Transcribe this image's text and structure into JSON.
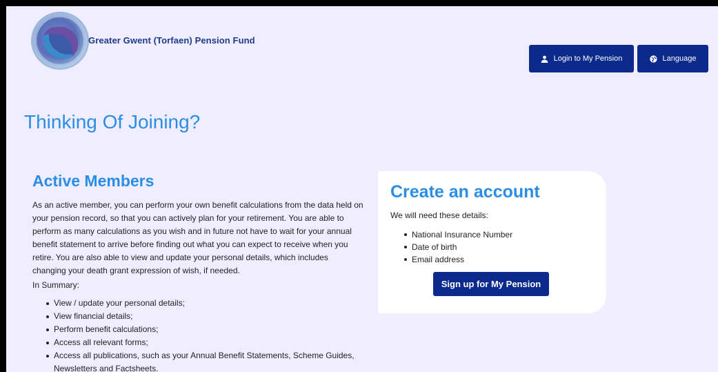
{
  "header": {
    "org_name": "Greater Gwent (Torfaen) Pension Fund",
    "login_label": "Login to My Pension",
    "language_label": "Language"
  },
  "main": {
    "page_title": "Thinking Of Joining?",
    "section_title": "Active Members",
    "body": "As an active member, you can perform your own benefit calculations from the data held on your pension record, so that you can actively plan for your retirement. You are able to perform as many calculations as you wish and in future not have to wait for your annual benefit statement to arrive before finding out what you can expect to receive when you retire. You are also able to view and update your personal details, which includes changing your death grant expression of wish, if needed.",
    "summary_label": "In Summary:",
    "summary_items": [
      "View / update your personal details;",
      "View financial details;",
      "Perform benefit calculations;",
      "Access all relevant forms;",
      "Access all publications, such as your Annual Benefit Statements, Scheme Guides, Newsletters and Factsheets."
    ]
  },
  "card": {
    "title": "Create an account",
    "subtitle": "We will need these details:",
    "items": [
      "National Insurance Number",
      "Date of birth",
      "Email address"
    ],
    "signup_label": "Sign up for My Pension"
  },
  "icons": {
    "login": "user-icon",
    "language": "globe-icon"
  },
  "colors": {
    "primary": "#0b2a8c",
    "heading": "#2a8ee6",
    "background": "#efedff"
  }
}
